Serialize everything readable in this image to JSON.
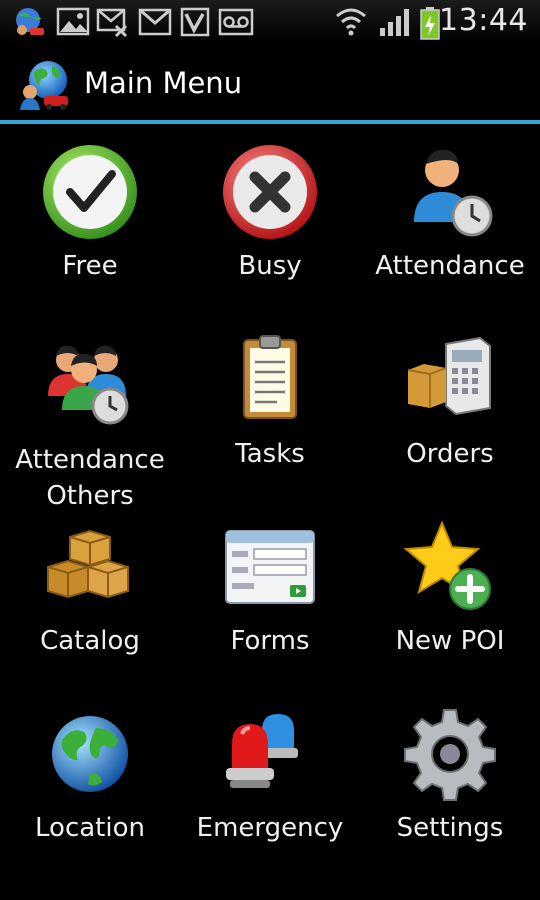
{
  "status_bar": {
    "time": "13:44",
    "icons": [
      "app-notification-icon",
      "gallery-icon",
      "missed-call-icon",
      "gmail-icon",
      "vine-icon",
      "voicemail-icon",
      "wifi-icon",
      "signal-icon",
      "battery-charging-icon"
    ]
  },
  "title_bar": {
    "title": "Main Menu",
    "icon": "globe-people-icon",
    "accent_color": "#33a6d9"
  },
  "menu": {
    "items": [
      {
        "label": "Free",
        "icon": "checkmark-icon"
      },
      {
        "label": "Busy",
        "icon": "x-icon"
      },
      {
        "label": "Attendance",
        "icon": "person-clock-icon"
      },
      {
        "label": "Attendance Others",
        "label_line1": "Attendance",
        "label_line2": "Others",
        "icon": "group-clock-icon"
      },
      {
        "label": "Tasks",
        "icon": "clipboard-icon"
      },
      {
        "label": "Orders",
        "icon": "box-calculator-icon"
      },
      {
        "label": "Catalog",
        "icon": "boxes-icon"
      },
      {
        "label": "Forms",
        "icon": "form-icon"
      },
      {
        "label": "New POI",
        "icon": "star-plus-icon"
      },
      {
        "label": "Location",
        "icon": "globe-icon"
      },
      {
        "label": "Emergency",
        "icon": "siren-icon"
      },
      {
        "label": "Settings",
        "icon": "gear-icon"
      }
    ]
  }
}
